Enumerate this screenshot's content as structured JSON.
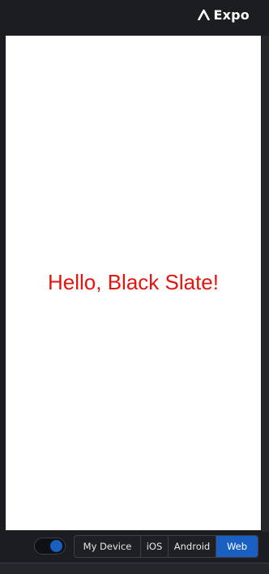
{
  "header": {
    "brand": "Expo",
    "logo_icon": "expo-chevron-icon"
  },
  "preview": {
    "message": "Hello, Black Slate!",
    "message_color": "#e5140f",
    "background": "#ffffff"
  },
  "controls": {
    "toggle_state": "on",
    "toggle_color": "#1a5fc2",
    "platforms": [
      "My Device",
      "iOS",
      "Android",
      "Web"
    ],
    "selected_platform": "Web"
  }
}
